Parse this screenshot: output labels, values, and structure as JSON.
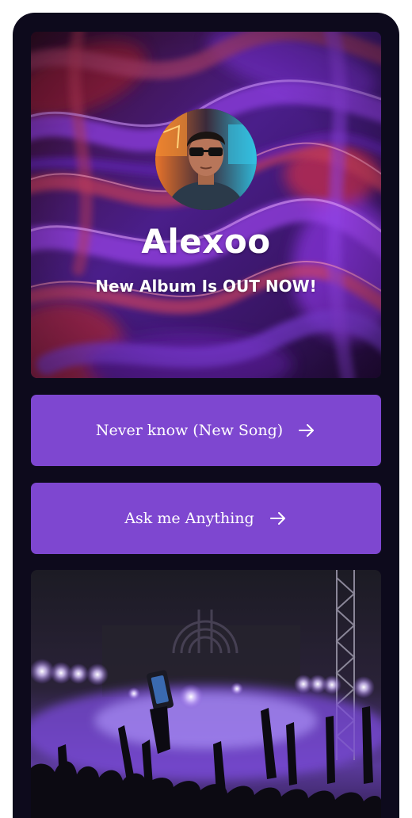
{
  "profile": {
    "name": "Alexoo",
    "tagline": "New Album Is OUT NOW!"
  },
  "links": [
    {
      "label": "Never know (New Song)",
      "icon": "arrow-right-icon"
    },
    {
      "label": "Ask me Anything",
      "icon": "arrow-right-icon"
    }
  ],
  "theme": {
    "background": "#0d0a1c",
    "button": "#7e47d0",
    "frame": "#ffffff",
    "text": "#ffffff"
  },
  "images": {
    "hero": "abstract-purple-red-swirl",
    "avatar": "man-with-sunglasses-neon",
    "feature": "concert-crowd-purple-lights"
  }
}
